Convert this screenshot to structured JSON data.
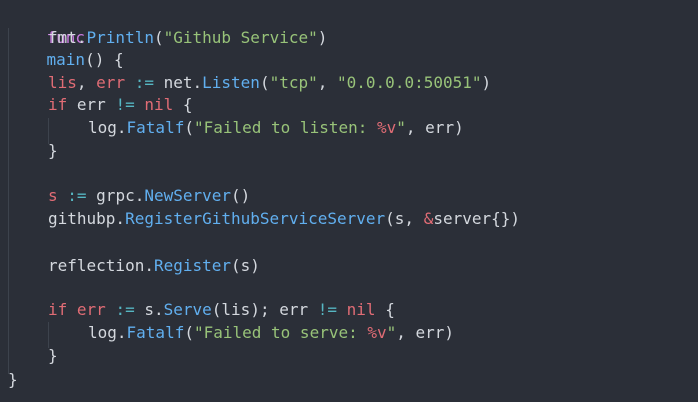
{
  "code": {
    "l1": {
      "kw": "func",
      "name": "main",
      "rest": "() {"
    },
    "l2": {
      "pkg": "fmt.",
      "fn": "Println",
      "open": "(",
      "str": "\"Github Service\"",
      "close": ")"
    },
    "l4": {
      "v1": "lis",
      "comma": ", ",
      "v2": "err",
      "op": " := ",
      "pkg": "net.",
      "fn": "Listen",
      "open": "(",
      "s1": "\"tcp\"",
      "sep": ", ",
      "s2": "\"0.0.0.0:50051\"",
      "close": ")"
    },
    "l5": {
      "kw": "if",
      "a": " err ",
      "op": "!=",
      "b": " ",
      "nil": "nil",
      "c": " {"
    },
    "l6": {
      "pkg": "log.",
      "fn": "Fatalf",
      "open": "(",
      "str": "\"Failed to listen: ",
      "fmt": "%v",
      "strend": "\"",
      "rest": ", err)"
    },
    "l7": {
      "brace": "}"
    },
    "l9": {
      "v": "s",
      "op": " := ",
      "pkg": "grpc.",
      "fn": "NewServer",
      "rest": "()"
    },
    "l10": {
      "pkg": "githubp.",
      "fn": "RegisterGithubServiceServer",
      "a": "(s, ",
      "amp": "&",
      "rest": "server{})"
    },
    "l12": {
      "pkg": "reflection.",
      "fn": "Register",
      "rest": "(s)"
    },
    "l14": {
      "kw": "if",
      "sp": " ",
      "v": "err",
      "op": " := ",
      "pkg": "s.",
      "fn": "Serve",
      "a": "(lis); err ",
      "op2": "!=",
      "b": " ",
      "nil": "nil",
      "c": " {"
    },
    "l15": {
      "pkg": "log.",
      "fn": "Fatalf",
      "open": "(",
      "str": "\"Failed to serve: ",
      "fmt": "%v",
      "strend": "\"",
      "rest": ", err)"
    },
    "l16": {
      "brace": "}"
    },
    "l17": {
      "brace": "}"
    }
  }
}
